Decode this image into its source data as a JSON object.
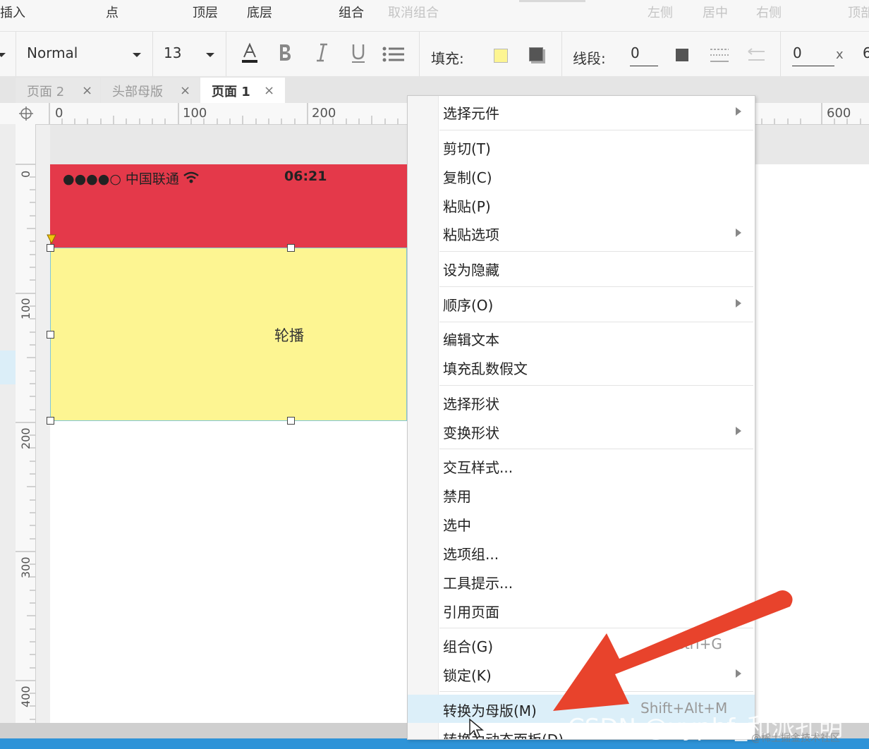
{
  "toolbar": {
    "row1": [
      "插入",
      "点",
      "顶层",
      "底层",
      "组合",
      "取消组合",
      "左侧",
      "居中",
      "右侧",
      "顶部"
    ],
    "style_select": "Normal",
    "font_size": "13",
    "fill_label": "填充:",
    "line_label": "线段:",
    "line_value": "0",
    "x_value": "0",
    "x_label": "x",
    "partial_value": "6"
  },
  "colors": {
    "accent_red": "#e4394a",
    "fill_yellow": "#fdf592",
    "menu_highlight": "#dceff9",
    "arrow_red": "#e8432c"
  },
  "tabs": [
    {
      "label": "页面 2",
      "close": "×"
    },
    {
      "label": "头部母版",
      "close": "×"
    },
    {
      "label": "页面 1",
      "close": "×",
      "active": true
    }
  ],
  "ruler": {
    "top": [
      "0",
      "100",
      "200",
      "600"
    ],
    "left": [
      "0",
      "100",
      "200",
      "300",
      "400"
    ]
  },
  "canvas": {
    "carrier": "●●●●○ 中国联通",
    "time": "06:21",
    "carousel_label": "轮播"
  },
  "context_menu": {
    "items": [
      {
        "label": "选择元件",
        "submenu": true
      },
      {
        "label": "剪切(T)"
      },
      {
        "label": "复制(C)"
      },
      {
        "label": "粘贴(P)"
      },
      {
        "label": "粘贴选项",
        "submenu": true
      },
      {
        "label": "设为隐藏"
      },
      {
        "label": "顺序(O)",
        "submenu": true
      },
      {
        "label": "编辑文本"
      },
      {
        "label": "填充乱数假文"
      },
      {
        "label": "选择形状"
      },
      {
        "label": "变换形状",
        "submenu": true
      },
      {
        "label": "交互样式..."
      },
      {
        "label": "禁用"
      },
      {
        "label": "选中"
      },
      {
        "label": "选项组..."
      },
      {
        "label": "工具提示..."
      },
      {
        "label": "引用页面"
      },
      {
        "label": "组合(G)",
        "shortcut": "Ctrl+G"
      },
      {
        "label": "锁定(K)",
        "submenu": true
      },
      {
        "label": "转换为母版(M)",
        "shortcut": "Shift+Alt+M",
        "highlighted": true
      },
      {
        "label": "转换为动态面板(D)"
      }
    ]
  },
  "watermark": {
    "main": "CSDN @xyphf_和派孔明",
    "sub": "@稀土掘金技术社区"
  }
}
